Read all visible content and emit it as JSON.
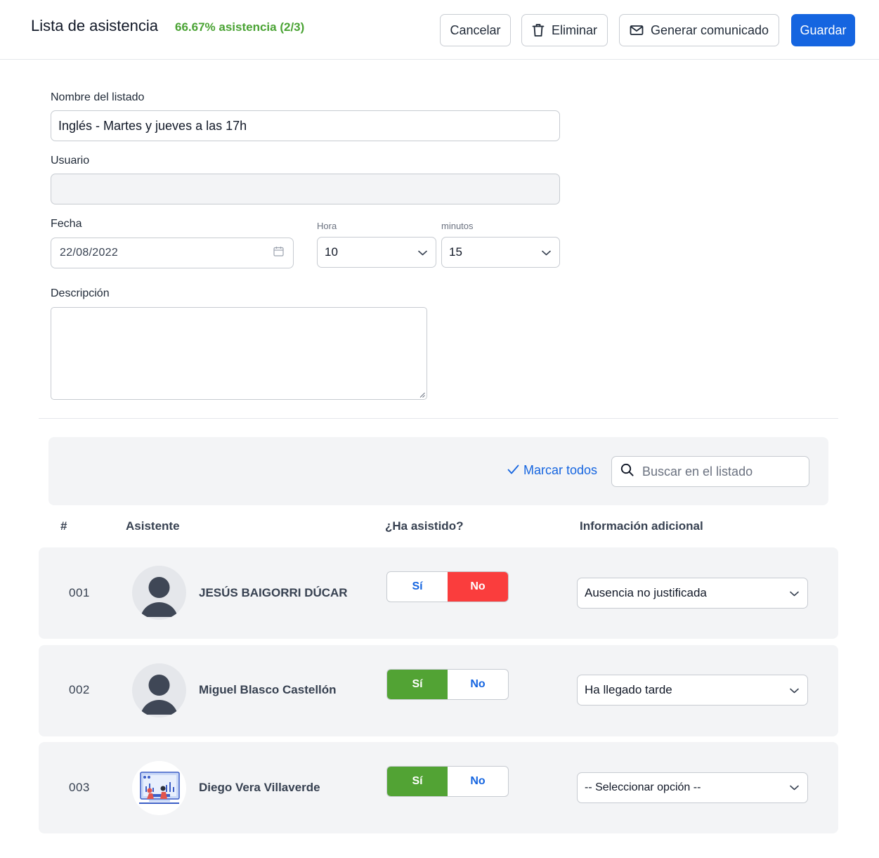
{
  "header": {
    "title": "Lista de asistencia",
    "attendance_summary": "66.67% asistencia (2/3)",
    "cancel_label": "Cancelar",
    "delete_label": "Eliminar",
    "generate_label": "Generar comunicado",
    "save_label": "Guardar"
  },
  "form": {
    "list_name_label": "Nombre del listado",
    "list_name_value": "Inglés - Martes y jueves a las 17h",
    "user_label": "Usuario",
    "user_value": "",
    "date_label": "Fecha",
    "date_value": "22/08/2022",
    "hour_label": "Hora",
    "hour_value": "10",
    "minutes_label": "minutos",
    "minutes_value": "15",
    "description_label": "Descripción",
    "description_value": ""
  },
  "toolbar": {
    "mark_all_label": "Marcar todos",
    "search_placeholder": "Buscar en el listado"
  },
  "table": {
    "headers": [
      "#",
      "Asistente",
      "¿Ha asistido?",
      "Información adicional"
    ],
    "yes_label": "Sí",
    "no_label": "No",
    "rows": [
      {
        "num": "001",
        "name": "JESÚS BAIGORRI DÚCAR",
        "attended": "no",
        "info": "Ausencia no justificada",
        "avatar": "default-avatar"
      },
      {
        "num": "002",
        "name": "Miguel Blasco Castellón",
        "attended": "si",
        "info": "Ha llegado tarde",
        "avatar": "default-avatar"
      },
      {
        "num": "003",
        "name": "Diego Vera Villaverde",
        "attended": "si",
        "info": "-- Seleccionar opción --",
        "avatar": "illustration-avatar"
      }
    ]
  },
  "colors": {
    "primary": "#1565e0",
    "success": "#52a334",
    "danger": "#fa3d3d",
    "summary_green": "#4aa334"
  }
}
